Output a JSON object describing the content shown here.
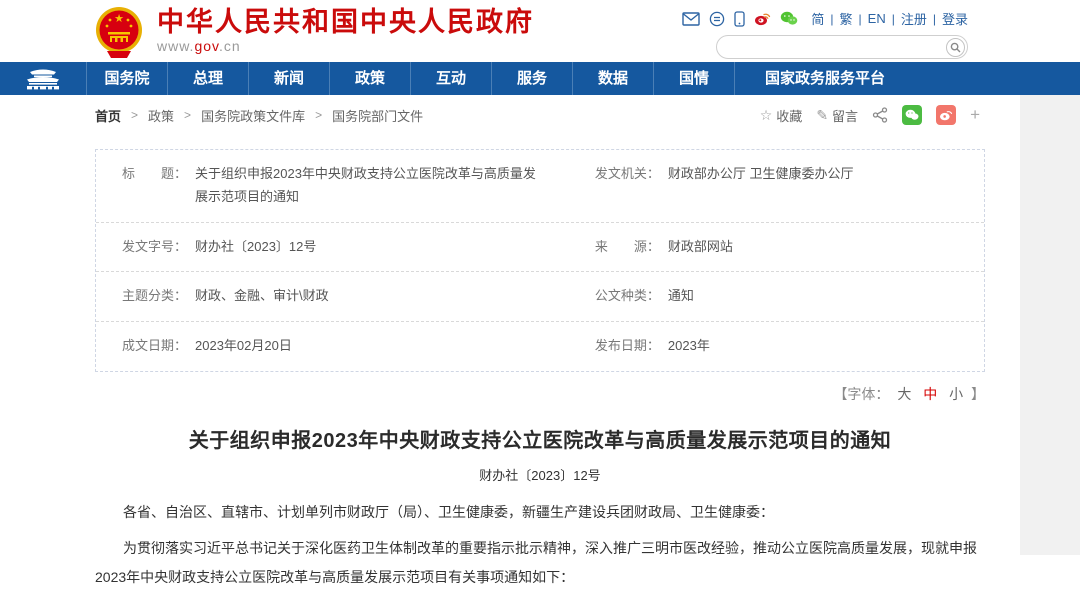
{
  "header": {
    "site_title": "中华人民共和国中央人民政府",
    "url_www": "www.",
    "url_gov": "gov",
    "url_cn": ".cn",
    "lang_links": [
      "简",
      "繁",
      "EN",
      "注册",
      "登录"
    ],
    "search_placeholder": "",
    "colors": {
      "masthead_red": "#ca0b0b",
      "nav_blue": "#15589f",
      "link_blue": "#2d64a3"
    }
  },
  "nav": {
    "items": [
      "国务院",
      "总理",
      "新闻",
      "政策",
      "互动",
      "服务",
      "数据",
      "国情",
      "国家政务服务平台"
    ]
  },
  "breadcrumb": {
    "items": [
      "首页",
      "政策",
      "国务院政策文件库",
      "国务院部门文件"
    ],
    "separator": ">"
  },
  "page_actions": {
    "favorite": "收藏",
    "comment": "留言",
    "plus": "+"
  },
  "meta": {
    "rows": [
      {
        "l_label": "标　　题：",
        "l_value": "关于组织申报2023年中央财政支持公立医院改革与高质量发展示范项目的通知",
        "r_label": "发文机关：",
        "r_value": "财政部办公厅 卫生健康委办公厅"
      },
      {
        "l_label": "发文字号：",
        "l_value": "财办社〔2023〕12号",
        "r_label": "来　　源：",
        "r_value": "财政部网站"
      },
      {
        "l_label": "主题分类：",
        "l_value": "财政、金融、审计\\财政",
        "r_label": "公文种类：",
        "r_value": "通知"
      },
      {
        "l_label": "成文日期：",
        "l_value": "2023年02月20日",
        "r_label": "发布日期：",
        "r_value": "2023年"
      }
    ]
  },
  "font_control": {
    "prefix": "【字体：",
    "large": "大",
    "medium": "中",
    "small": "小",
    "suffix": "】",
    "active": "中"
  },
  "article": {
    "title": "关于组织申报2023年中央财政支持公立医院改革与高质量发展示范项目的通知",
    "doc_no": "财办社〔2023〕12号",
    "paragraphs": [
      "各省、自治区、直辖市、计划单列市财政厅（局）、卫生健康委，新疆生产建设兵团财政局、卫生健康委：",
      "为贯彻落实习近平总书记关于深化医药卫生体制改革的重要指示批示精神，深入推广三明市医改经验，推动公立医院高质量发展，现就申报2023年中央财政支持公立医院改革与高质量发展示范项目有关事项通知如下："
    ]
  }
}
